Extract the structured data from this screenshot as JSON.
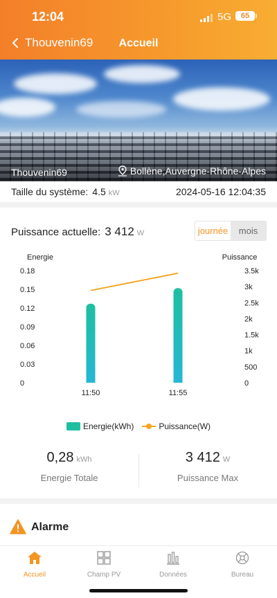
{
  "status_bar": {
    "time": "12:04",
    "network": "5G",
    "battery": "65"
  },
  "nav": {
    "back_label": "Thouvenin69",
    "title": "Accueil"
  },
  "banner": {
    "plant_name": "Thouvenin69",
    "location": "Bollène,Auvergne-Rhône-Alpes"
  },
  "info": {
    "system_size_label": "Taille du système:",
    "system_size_value": "4.5",
    "system_size_unit": "kW",
    "timestamp": "2024-05-16 12:04:35"
  },
  "power": {
    "label": "Puissance actuelle:",
    "value": "3 412",
    "unit": "W"
  },
  "toggle": {
    "day": "journée",
    "month": "mois"
  },
  "chart_data": {
    "type": "bar",
    "categories": [
      "11:50",
      "11:55"
    ],
    "left_axis": {
      "label": "Energie",
      "ticks": [
        "0",
        "0.03",
        "0.06",
        "0.09",
        "0.12",
        "0.15",
        "0.18"
      ],
      "ylim": [
        0,
        0.18
      ]
    },
    "right_axis": {
      "label": "Puissance",
      "ticks": [
        "0",
        "500",
        "1k",
        "1.5k",
        "2k",
        "2.5k",
        "3k",
        "3.5k"
      ],
      "ylim": [
        0,
        3500
      ]
    },
    "series": [
      {
        "name": "Energie(kWh)",
        "type": "bar",
        "axis": "left",
        "values": [
          0.127,
          0.152
        ],
        "color": "#1ebfa0"
      },
      {
        "name": "Puissance(W)",
        "type": "line",
        "axis": "right",
        "values": [
          2880,
          3420
        ],
        "color": "#f6a623"
      }
    ],
    "grid": false,
    "legend": "bottom"
  },
  "stats": {
    "total_energy_value": "0,28",
    "total_energy_unit": "kWh",
    "total_energy_label": "Energie Totale",
    "max_power_value": "3 412",
    "max_power_unit": "W",
    "max_power_label": "Puissance Max"
  },
  "alarm": {
    "title": "Alarme"
  },
  "tabs": [
    {
      "label": "Accueil",
      "icon": "home-icon"
    },
    {
      "label": "Champ PV",
      "icon": "grid-icon"
    },
    {
      "label": "Données",
      "icon": "data-chart-icon"
    },
    {
      "label": "Bureau",
      "icon": "office-icon"
    }
  ],
  "colors": {
    "accent": "#f39523",
    "header_start": "#f47f2a",
    "header_end": "#f8ad33",
    "bar_top": "#1ebfa0",
    "bar_bottom": "#26b7d4"
  }
}
